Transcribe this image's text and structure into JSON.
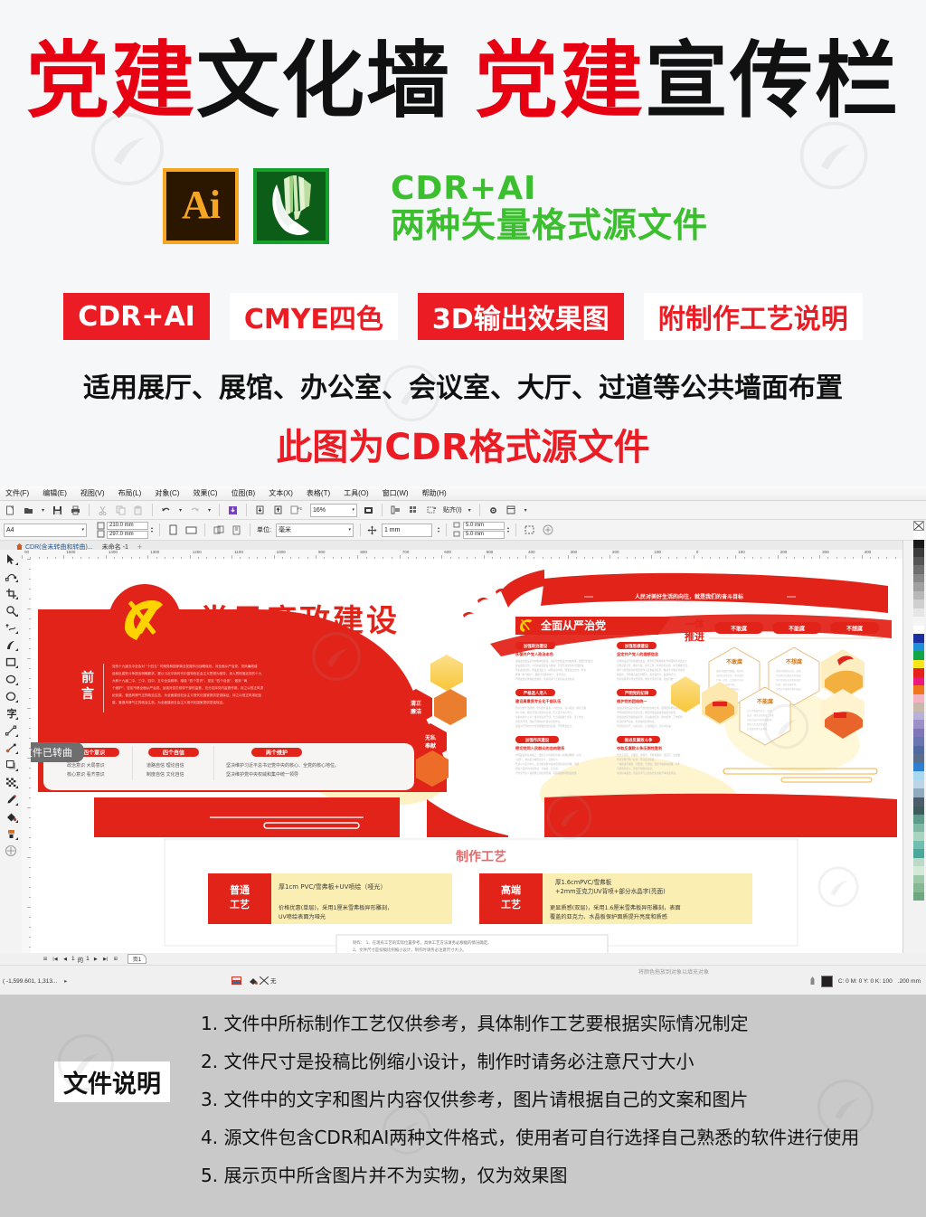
{
  "promo": {
    "title_parts": [
      {
        "text": "党建",
        "color": "red"
      },
      {
        "text": "文化墙",
        "color": "black"
      },
      {
        "text": "党建",
        "color": "red"
      },
      {
        "text": "宣传栏",
        "color": "black"
      }
    ],
    "ai_logo_text": "Ai",
    "format_line1": "CDR+AI",
    "format_line2": "两种矢量格式源文件",
    "badges": [
      {
        "label": "CDR+AI",
        "style": "fill"
      },
      {
        "label": "CMYE四色",
        "style": "ghost"
      },
      {
        "label": "3D输出效果图",
        "style": "fill"
      },
      {
        "label": "附制作工艺说明",
        "style": "ghost"
      }
    ],
    "usage_line": "适用展厅、展馆、办公室、会议室、大厅、过道等公共墙面布置",
    "cdr_line": "此图为CDR格式源文件",
    "colors": {
      "red": "#e60012",
      "badge_red": "#ec1c24",
      "green": "#3bbf2e",
      "black": "#111111"
    }
  },
  "app": {
    "menus": [
      "文件(F)",
      "编辑(E)",
      "视图(V)",
      "布局(L)",
      "对象(C)",
      "效果(C)",
      "位图(B)",
      "文本(X)",
      "表格(T)",
      "工具(O)",
      "窗口(W)",
      "帮助(H)"
    ],
    "zoom_level": "16%",
    "zoom_dropdown_label": "贴齐(I)",
    "page_preset": "A4",
    "page_width": "210.0 mm",
    "page_height": "297.0 mm",
    "units_label": "单位:",
    "units_value": "毫米",
    "nudge_value": "1 mm",
    "duplicate_x": "5.0 mm",
    "duplicate_y": "5.0 mm",
    "tabs": [
      {
        "label": "CDR(含未转曲和转曲)...",
        "active": true
      },
      {
        "label": "未命名 -1",
        "active": false
      }
    ],
    "curves_badge": "文件已转曲",
    "page_nav": {
      "current": "1",
      "of_label": "的",
      "total": "1",
      "page_tab": "页1"
    },
    "status_coord": "( -1,599.601, 1,313...",
    "status_hint": "将颜色拖放到对象以填充对象",
    "status_fill_none": "无",
    "status_color": "C: 0 M: 0 Y: 0 K: 100",
    "status_outline": ".200 mm",
    "ruler_ticks": [
      "00",
      "1500",
      "1400",
      "1300",
      "1200",
      "1100",
      "1000",
      "900",
      "800",
      "700",
      "600",
      "500",
      "400",
      "300",
      "200",
      "100",
      "0",
      "100",
      "200",
      "300",
      "400"
    ],
    "toolbox_tools": [
      "pick-tool",
      "shape-tool",
      "crop-tool",
      "zoom-tool",
      "freehand-tool",
      "artistic-media-tool",
      "rectangle-tool",
      "ellipse-tool",
      "polygon-tool",
      "text-tool",
      "parallel-dimension-tool",
      "straight-line-connector-tool",
      "drop-shadow-tool",
      "transparency-tool",
      "color-eyedropper-tool",
      "interactive-fill-tool",
      "smart-fill-tool",
      "outline-tool"
    ],
    "palette_colors": [
      "#ffffff",
      "#1a1a1a",
      "#3b3b3b",
      "#555555",
      "#6e6e6e",
      "#888888",
      "#a0a0a0",
      "#b8b8b8",
      "#cfcfcf",
      "#e6e6e6",
      "#f5f5f5",
      "#ffffff",
      "#1b2f9e",
      "#1f8fd6",
      "#12a64a",
      "#f5e61b",
      "#e5211c",
      "#ea1a7f",
      "#f0741a",
      "#f3b3c2",
      "#c9b9aa",
      "#b9b2d6",
      "#9b90c8",
      "#7f76b8",
      "#6a74b0",
      "#4f6aa0",
      "#5a6e8c",
      "#2f7fd0",
      "#a8d7f0",
      "#bcd4e6",
      "#8fa9bd",
      "#4b5c6b",
      "#3f5b5b",
      "#5c9a8a",
      "#7fb8a4",
      "#a8d4c0",
      "#6fbfb0",
      "#4aa89a",
      "#bcd9c8",
      "#d4e8d8",
      "#9dc9a8",
      "#86b894",
      "#6fa87e"
    ]
  },
  "artwork": {
    "main_title": "党风廉政建设",
    "preface_label": "前言",
    "preface_body": "党的十九届五中全会对 “十四五” 时期党和国家事业发展作出战略谋划，对全面从严治党、党风廉政建设和反腐败斗争提出明确要求。要以习近平新时代中国特色社会主义思想为指导，深入贯彻落实党的十九大和十九届二中、三中、四中、五中全会精神，增强 “四个意识”、坚定 “四个自信”、做到 “两个维护”，坚定不移全面从严治党，加强对党员领导干部的监督，充分发挥党内监督作用，持之以恒正风肃纪反腐，营造风清气正的政治生态，为全面建设社会主义现代化国家提供坚强保证。",
    "banner_slogan": "人民对美好生活的向往，就是我们的奋斗目标",
    "bottom_cards": [
      {
        "title": "四个意识",
        "lines": [
          "政治意识 大局意识",
          "核心意识 看齐意识"
        ]
      },
      {
        "title": "四个自信",
        "lines": [
          "道路自信  理论自信",
          "制度自信  文化自信"
        ]
      },
      {
        "title": "两个维护",
        "lines": [
          "坚决维护习近平总书记党中央的核心、全党的核心地位。",
          "坚决维护党中央权威和集中统一领导"
        ]
      }
    ],
    "hex_labels": [
      "清正廉洁",
      "无私奉献"
    ],
    "section_title": "全面从严治党",
    "section_items": [
      {
        "title": "加强政治建设",
        "sub": "永葆共产党人政治本色"
      },
      {
        "title": "加强思想建设",
        "sub": "坚定共产党人的理想信念"
      },
      {
        "title": "严格选人用人",
        "sub": "建设高素质专业化干部队伍"
      },
      {
        "title": "严明党的纪律",
        "sub": "维护党的团结统一"
      },
      {
        "title": "加强作风建设",
        "sub": "密切党同人民群众的血肉联系"
      },
      {
        "title": "推进反腐败斗争",
        "sub": "夺取反腐败斗争压倒性胜利"
      }
    ],
    "promote_label": "一体推进",
    "promote_pills": [
      "不敢腐",
      "不能腐",
      "不想腐"
    ],
    "promote_hexes": [
      "不敢腐",
      "不想腐",
      "不能腐"
    ],
    "process_title": "制作工艺",
    "process_rows": [
      {
        "name": "普通\n工艺",
        "spec": "厚1cm PVC/雪弗板+UV喷绘（哑光）",
        "desc": "价格优惠(单层)，采用1厘米雪弗板异形雕刻，UV喷绘表面为哑光"
      },
      {
        "name": "高端\n工艺",
        "spec": "厚1.6cmPVC/雪弗板\n+2mm亚克力UV背喷+部分水晶字(亮面)",
        "desc": "更显质感(双层)，采用1.6厘米雪弗板异形雕刻，表面覆盖的亚克力、水晶板保护面质提升亮度和质感"
      }
    ],
    "colors": {
      "brand_red": "#e2231a",
      "deep_red": "#d8232a",
      "gold": "#fdc31f",
      "cream": "#fbf0c0"
    }
  },
  "notes": {
    "label": "文件说明",
    "items": [
      "1. 文件中所标制作工艺仅供参考，具体制作工艺要根据实际情况制定",
      "2. 文件尺寸是投稿比例缩小设计，制作时请务必注意尺寸大小",
      "3. 文件中的文字和图片内容仅供参考，图片请根据自己的文案和图片",
      "4. 源文件包含CDR和AI两种文件格式，使用者可自行选择自己熟悉的软件进行使用",
      "5. 展示页中所含图片并不为实物，仅为效果图"
    ]
  }
}
